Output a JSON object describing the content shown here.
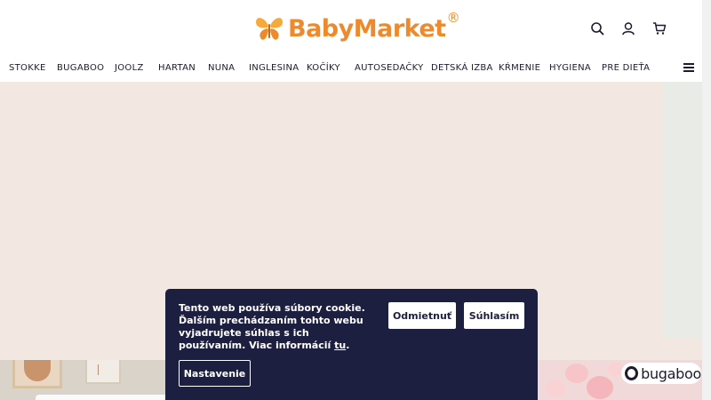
{
  "header": {
    "logo_text": "BabyMarket",
    "logo_reg": "®",
    "icons": [
      "search-icon",
      "user-icon",
      "cart-icon"
    ]
  },
  "nav": {
    "items": [
      {
        "label": "STOKKE"
      },
      {
        "label": "BUGABOO"
      },
      {
        "label": "JOOLZ"
      },
      {
        "label": "HARTAN"
      },
      {
        "label": "NUNA"
      },
      {
        "label": "INGLESINA"
      },
      {
        "label": "KOČÍKY"
      },
      {
        "label": "AUTOSEDAČKY"
      },
      {
        "label": "DETSKÁ IZBA"
      },
      {
        "label": "KŔMENIE"
      },
      {
        "label": "HYGIENA"
      },
      {
        "label": "PRE DIEŤA"
      }
    ],
    "menu_icon": "hamburger-menu-icon"
  },
  "banner": {
    "brand": "bugaboo"
  },
  "cookie": {
    "message": "Tento web používa súbory cookie. Ďalším prechádzaním tohto webu vyjadrujete súhlas s ich používaním. Viac informácií ",
    "link_text": "tu",
    "after_link": ".",
    "reject_label": "Odmietnuť",
    "accept_label": "Súhlasím",
    "settings_label": "Nastavenie"
  },
  "colors": {
    "brand_orange": "#ef8a2c",
    "dialog_navy": "#1d1f40",
    "hero_bg": "#f3e8e1"
  }
}
